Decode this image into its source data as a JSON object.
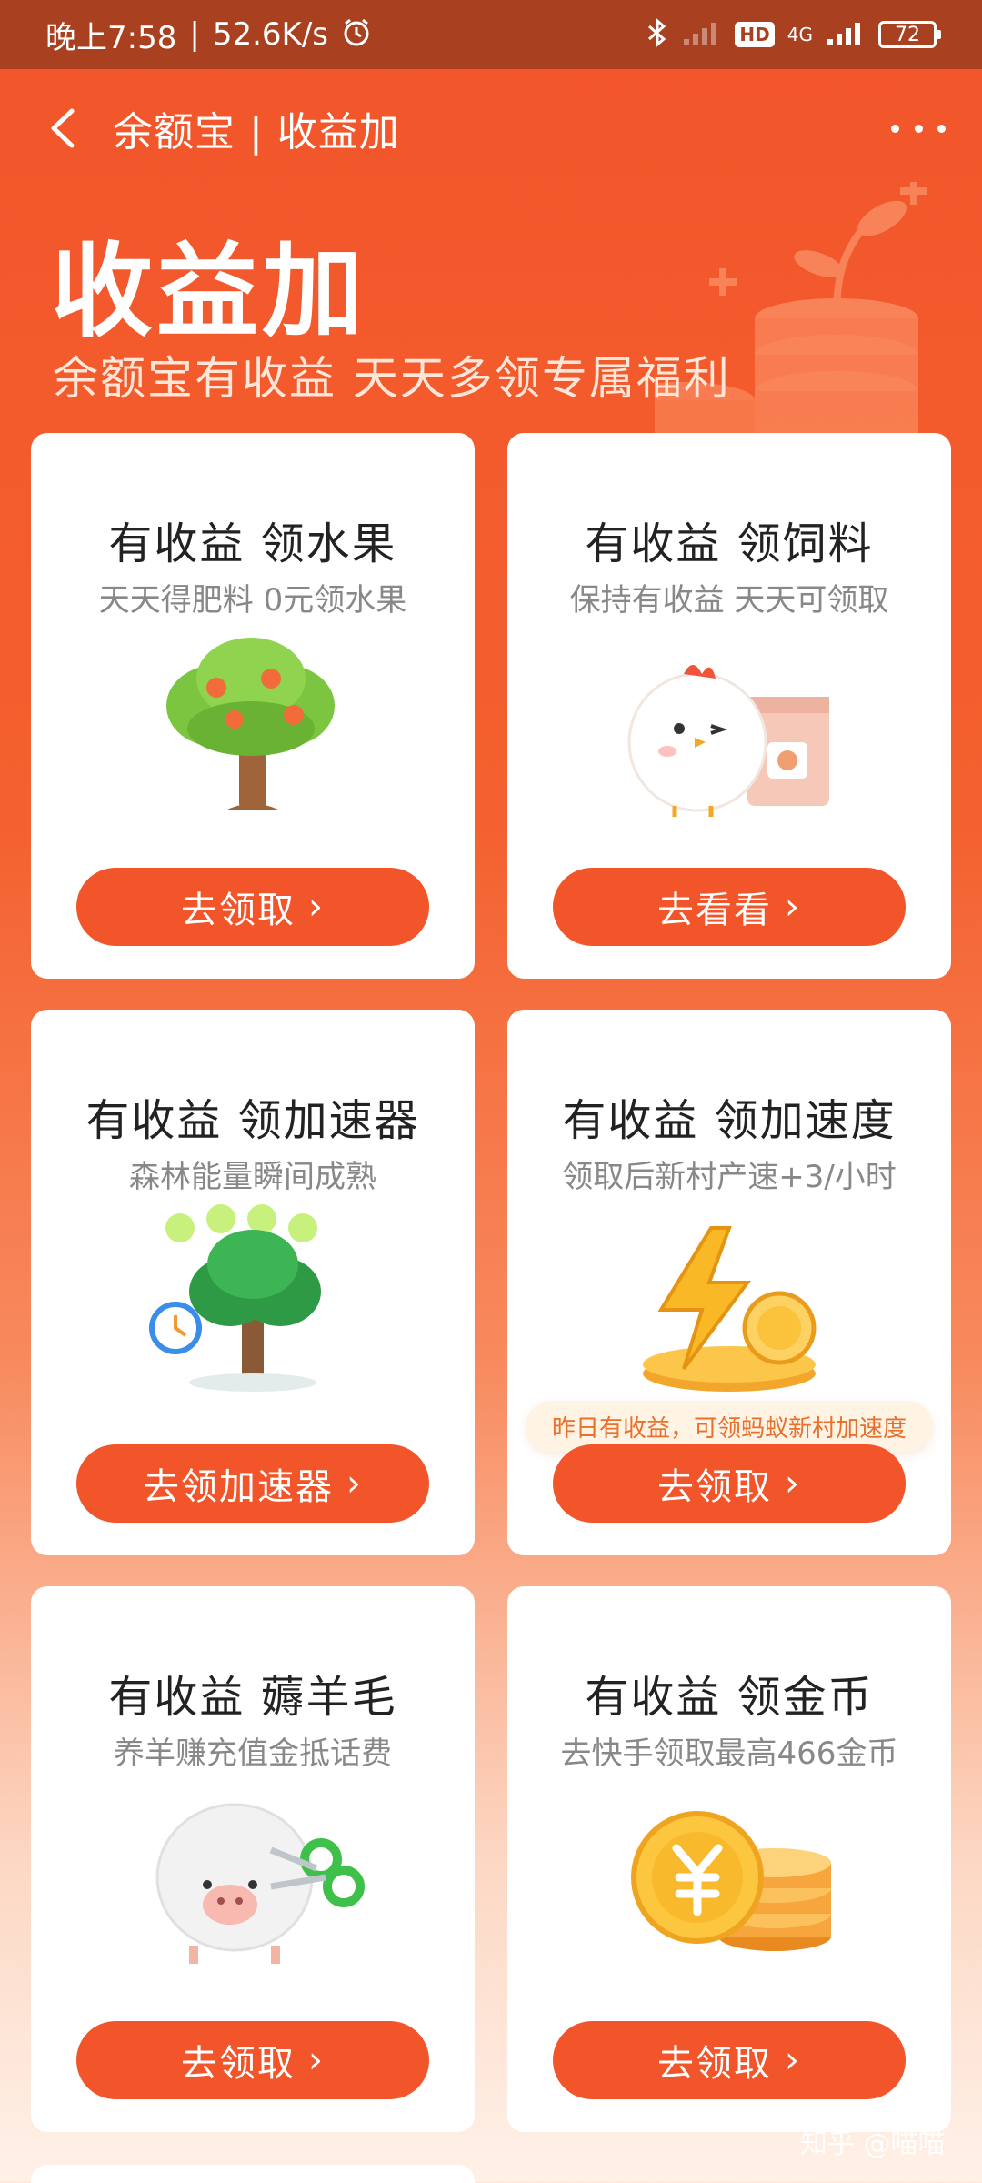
{
  "status_bar": {
    "time": "晚上7:58",
    "speed": "52.6K/s",
    "network": "4G",
    "hd": "HD",
    "battery": "72",
    "icons": [
      "alarm-icon",
      "bluetooth-icon",
      "signal-icon",
      "battery-icon"
    ]
  },
  "nav": {
    "back_icon": "chevron-left-icon",
    "title": "余额宝 | 收益加",
    "more_icon": "more-dots-icon"
  },
  "hero": {
    "title": "收益加",
    "subtitle": "余额宝有收益 天天多领专属福利"
  },
  "cards": [
    {
      "title": "有收益 领水果",
      "subtitle": "天天得肥料 0元领水果",
      "button": "去领取",
      "image": "fruit-tree"
    },
    {
      "title": "有收益 领饲料",
      "subtitle": "保持有收益 天天可领取",
      "button": "去看看",
      "image": "chick-feed"
    },
    {
      "title": "有收益 领加速器",
      "subtitle": "森林能量瞬间成熟",
      "button": "去领加速器",
      "image": "forest-accelerator"
    },
    {
      "title": "有收益 领加速度",
      "subtitle": "领取后新村产速+3/小时",
      "button": "去领取",
      "tip": "昨日有收益，可领蚂蚁新村加速度",
      "image": "lightning-coin"
    },
    {
      "title": "有收益 薅羊毛",
      "subtitle": "养羊赚充值金抵话费",
      "button": "去领取",
      "image": "sheep"
    },
    {
      "title": "有收益 领金币",
      "subtitle": "去快手领取最高466金币",
      "button": "去领取",
      "image": "gold-coins"
    }
  ],
  "button_chevron": "›",
  "watermark": "知乎 @喵喵",
  "colors": {
    "accent": "#F2552A",
    "status_bar": "#A9401F",
    "card": "#FFFFFF",
    "tip_text": "#E8702C"
  }
}
